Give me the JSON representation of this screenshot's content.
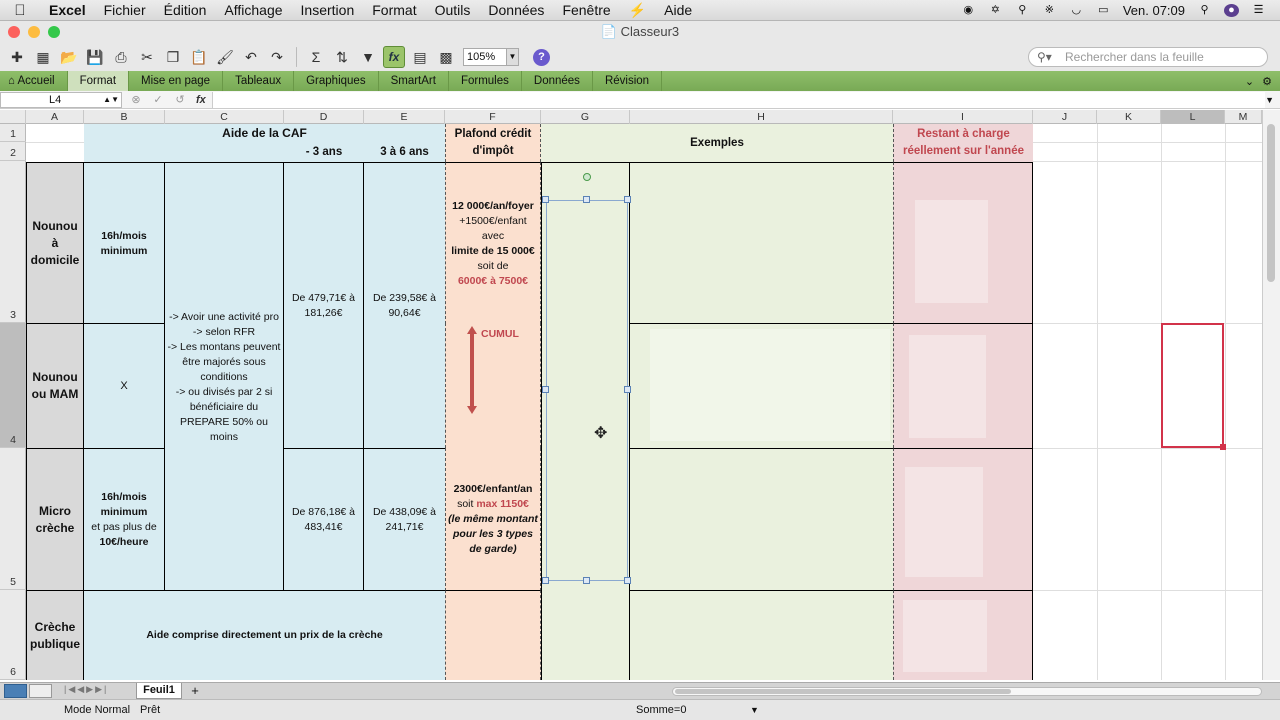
{
  "menubar": {
    "items": [
      "Excel",
      "Fichier",
      "Édition",
      "Affichage",
      "Insertion",
      "Format",
      "Outils",
      "Données",
      "Fenêtre",
      "Aide"
    ],
    "clock": "Ven. 07:09"
  },
  "window": {
    "title": "Classeur3"
  },
  "toolbar": {
    "zoom": "105%",
    "search_placeholder": "Rechercher dans la feuille"
  },
  "ribbon": {
    "tabs": [
      "Accueil",
      "Format",
      "Mise en page",
      "Tableaux",
      "Graphiques",
      "SmartArt",
      "Formules",
      "Données",
      "Révision"
    ],
    "active": "Format"
  },
  "formula_bar": {
    "name_box": "L4",
    "fx": "fx",
    "content": ""
  },
  "columns": [
    "A",
    "B",
    "C",
    "D",
    "E",
    "F",
    "G",
    "H",
    "I",
    "J",
    "K",
    "L",
    "M"
  ],
  "selected_column": "L",
  "rows": [
    "1",
    "2",
    "3",
    "4",
    "5",
    "6"
  ],
  "selected_row": "4",
  "sheet": {
    "caf_header": "Aide de la CAF",
    "under3_header": "- 3 ans",
    "age3to6_header": "3 à 6 ans",
    "plafond_header": "Plafond crédit d'impôt",
    "exemples_header": "Exemples",
    "restant_header": "Restant à charge réellement sur l'année",
    "row_nounou_dom": "Nounou à domicile",
    "row_nounou_mam": "Nounou ou MAM",
    "row_micro": "Micro crèche",
    "row_creche": "Crèche publique",
    "nounou_dom_hours": "16h/mois minimum",
    "mam_hours": "X",
    "micro_hours_1": "16h/mois minimum",
    "micro_hours_2": "et pas plus de",
    "micro_hours_3": "10€/heure",
    "conditions": "-> Avoir une activité pro\n-> selon RFR\n-> Les montans peuvent être majorés sous conditions\n-> ou divisés par 2 si bénéficiaire du PREPARE 50% ou moins",
    "dom_under3": "De 479,71€ à 181,26€",
    "dom_3to6": "De 239,58€ à 90,64€",
    "micro_under3": "De 876,18€ à 483,41€",
    "micro_3to6": "De 438,09€ à 241,71€",
    "plafond_dom_1": "12 000€/an/foyer",
    "plafond_dom_2": "+1500€/enfant avec",
    "plafond_dom_3": "limite de 15 000€",
    "plafond_dom_4": "soit de",
    "plafond_dom_5": "6000€ à 7500€",
    "cumul": "CUMUL",
    "plafond_micro_1": "2300€/enfant/an",
    "plafond_micro_2": "soit",
    "plafond_micro_3": "max 1150€",
    "plafond_micro_4": "(le même montant pour les 3 types de garde)",
    "creche_aide": "Aide comprise directement un prix de la crèche"
  },
  "sheet_tabs": {
    "active": "Feuil1"
  },
  "statusbar": {
    "mode": "Mode Normal",
    "state": "Prêt",
    "sum": "Somme=0"
  }
}
